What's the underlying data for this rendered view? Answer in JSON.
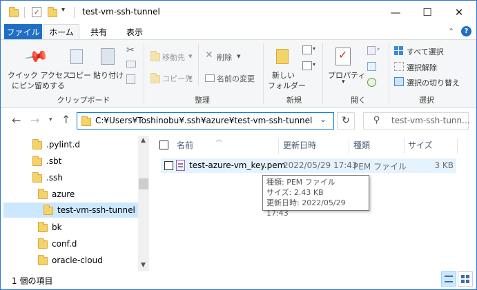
{
  "window": {
    "title": "test-vm-ssh-tunnel",
    "controls": {
      "minimize": "—",
      "maximize": "☐",
      "close": "✕"
    }
  },
  "ribbon_tabs": {
    "file": "ファイル",
    "home": "ホーム",
    "share": "共有",
    "view": "表示"
  },
  "ribbon": {
    "pin_quick_access": [
      "クイック アクセス",
      "にピン留めする"
    ],
    "copy": "コピー",
    "paste": "貼り付け",
    "clipboard_group": "クリップボード",
    "move_to": "移動先",
    "copy_to": "コピー先",
    "delete": "削除",
    "rename": "名前の変更",
    "organize_group": "整理",
    "new_folder": [
      "新しい",
      "フォルダー"
    ],
    "new_group": "新規",
    "properties": "プロパティ",
    "open_group": "開く",
    "select_all": "すべて選択",
    "select_none": "選択解除",
    "invert_selection": "選択の切り替え",
    "select_group": "選択"
  },
  "address_bar": {
    "path": "C:¥Users¥Toshinobu¥.ssh¥azure¥test-vm-ssh-tunnel",
    "search_placeholder": "test-vm-ssh-tunn..."
  },
  "nav_tree": [
    {
      "label": ".pylint.d",
      "indent": 0,
      "selected": false
    },
    {
      "label": ".sbt",
      "indent": 0,
      "selected": false
    },
    {
      "label": ".ssh",
      "indent": 0,
      "selected": false
    },
    {
      "label": "azure",
      "indent": 1,
      "selected": false
    },
    {
      "label": "test-vm-ssh-tunnel",
      "indent": 2,
      "selected": true
    },
    {
      "label": "bk",
      "indent": 1,
      "selected": false
    },
    {
      "label": "conf.d",
      "indent": 1,
      "selected": false
    },
    {
      "label": "oracle-cloud",
      "indent": 1,
      "selected": false
    }
  ],
  "columns": {
    "name": "名前",
    "modified": "更新日時",
    "type": "種類",
    "size": "サイズ"
  },
  "files": [
    {
      "name": "test-azure-vm_key.pem",
      "modified": "2022/05/29 17:43",
      "type": "PEM ファイル",
      "size": "3 KB"
    }
  ],
  "tooltip": {
    "type": "種類: PEM ファイル",
    "size": "サイズ: 2.43 KB",
    "modified": "更新日時: 2022/05/29 17:43"
  },
  "status": {
    "item_count": "1 個の項目"
  },
  "colors": {
    "accent": "#1f6fc4",
    "selection": "#cce8ff",
    "hover_row": "#e5f3ff",
    "folder": "#f5d36b"
  }
}
